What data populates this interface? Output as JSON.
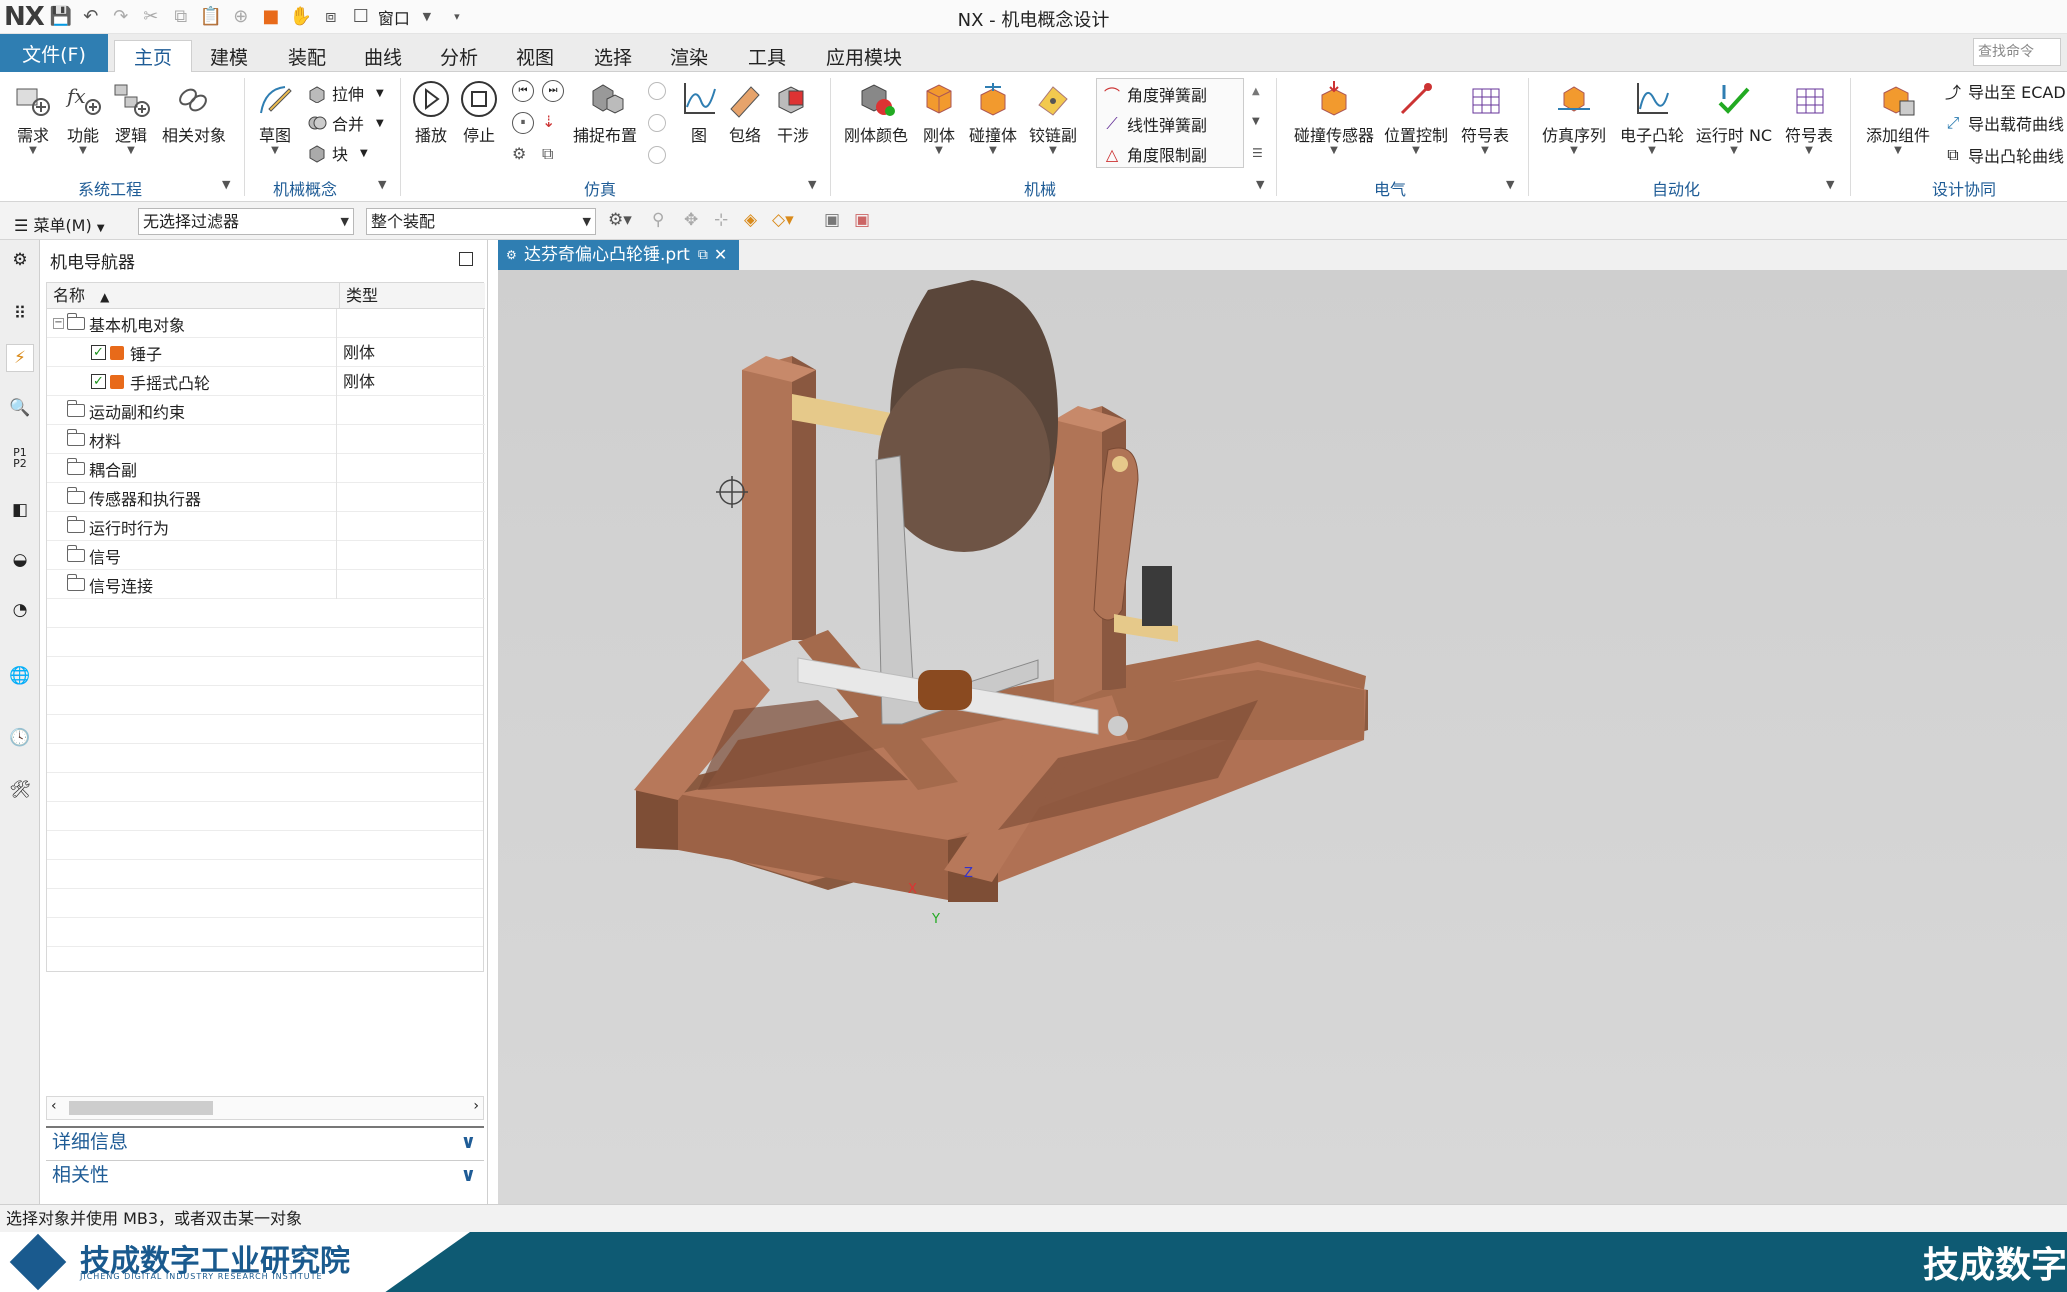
{
  "app": {
    "logo": "NX",
    "title": "NX - 机电概念设计",
    "window_menu": "窗口"
  },
  "ribbon_tabs": [
    {
      "label": "文件(F)"
    },
    {
      "label": "主页"
    },
    {
      "label": "建模"
    },
    {
      "label": "装配"
    },
    {
      "label": "曲线"
    },
    {
      "label": "分析"
    },
    {
      "label": "视图"
    },
    {
      "label": "选择"
    },
    {
      "label": "渲染"
    },
    {
      "label": "工具"
    },
    {
      "label": "应用模块"
    }
  ],
  "search": {
    "placeholder": "查找命令"
  },
  "groups": {
    "system": {
      "label": "系统工程",
      "buttons": [
        {
          "label": "需求"
        },
        {
          "label": "功能"
        },
        {
          "label": "逻辑"
        },
        {
          "label": "相关对象"
        }
      ]
    },
    "concept": {
      "label": "机械概念",
      "sketch": "草图",
      "small": [
        {
          "label": "拉伸"
        },
        {
          "label": "合并"
        },
        {
          "label": "块"
        }
      ]
    },
    "sim": {
      "label": "仿真",
      "buttons": [
        {
          "label": "播放"
        },
        {
          "label": "停止"
        },
        {
          "label": "捕捉布置"
        },
        {
          "label": "图"
        },
        {
          "label": "包络"
        },
        {
          "label": "干涉"
        }
      ]
    },
    "mech": {
      "label": "机械",
      "buttons": [
        {
          "label": "刚体颜色"
        },
        {
          "label": "刚体"
        },
        {
          "label": "碰撞体"
        },
        {
          "label": "铰链副"
        }
      ],
      "list": [
        {
          "label": "角度弹簧副"
        },
        {
          "label": "线性弹簧副"
        },
        {
          "label": "角度限制副"
        }
      ]
    },
    "elec": {
      "label": "电气",
      "buttons": [
        {
          "label": "碰撞传感器"
        },
        {
          "label": "位置控制"
        },
        {
          "label": "符号表"
        }
      ]
    },
    "auto": {
      "label": "自动化",
      "buttons": [
        {
          "label": "仿真序列"
        },
        {
          "label": "电子凸轮"
        },
        {
          "label": "运行时 NC"
        },
        {
          "label": "符号表"
        }
      ]
    },
    "collab": {
      "label": "设计协同",
      "add": "添加组件",
      "small": [
        {
          "label": "导出至 ECAD"
        },
        {
          "label": "导出载荷曲线"
        },
        {
          "label": "导出凸轮曲线"
        }
      ]
    }
  },
  "toolbar": {
    "menu": "菜单(M)",
    "filter": "无选择过滤器",
    "scope": "整个装配"
  },
  "navigator": {
    "title": "机电导航器",
    "col_name": "名称",
    "col_type": "类型",
    "rows": [
      {
        "label": "基本机电对象",
        "type": ""
      },
      {
        "label": "锤子",
        "type": "刚体"
      },
      {
        "label": "手摇式凸轮",
        "type": "刚体"
      },
      {
        "label": "运动副和约束",
        "type": ""
      },
      {
        "label": "材料",
        "type": ""
      },
      {
        "label": "耦合副",
        "type": ""
      },
      {
        "label": "传感器和执行器",
        "type": ""
      },
      {
        "label": "运行时行为",
        "type": ""
      },
      {
        "label": "信号",
        "type": ""
      },
      {
        "label": "信号连接",
        "type": ""
      }
    ],
    "details": "详细信息",
    "relations": "相关性"
  },
  "document": {
    "tab": "达芬奇偏心凸轮锤.prt"
  },
  "triad": {
    "x": "X",
    "y": "Y",
    "z": "Z"
  },
  "status": {
    "text": "选择对象并使用 MB3，或者双击某一对象"
  },
  "brand": {
    "name": "技成数字工业研究院",
    "sub": "JICHENG DIGITAL INDUSTRY RESEARCH INSTITUTE",
    "right": "技成数字"
  },
  "colors": {
    "accent": "#2f7eb2",
    "wood": "#b87556",
    "shaft": "#e6c98a",
    "disk": "#6e5445"
  }
}
